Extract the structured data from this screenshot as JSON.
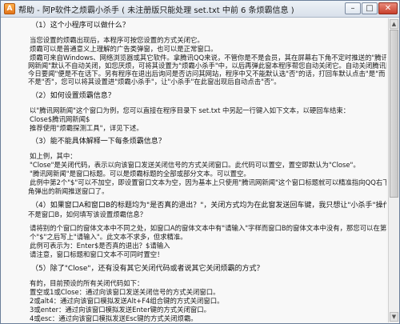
{
  "window": {
    "title": "帮助 - 阿P软件之烦霸小杀手 ( 未注册版只能处理 set.txt 中前 6 条烦霸信息 )",
    "app_icon": "A",
    "min_icon": "–",
    "max_icon": "□",
    "close_icon": "✕"
  },
  "scrollbar": {
    "up": "▲",
    "down": "▼"
  },
  "content": {
    "q1": "（1）这个小程序可以做什么？",
    "p1_l1": "当您设置的烦霸出现后，本程序可按您设置的方式关闭它。",
    "p1_l2": "烦霸可以是普通意义上理解的广告类弹窗，也可以是正常窗口。",
    "p1_l3": "烦霸可来自Windows、网络浏览器或其它软件。拿腾讯QQ来说，不管你是不是会员，其在屏幕右下角不定时推送的\"腾讯",
    "p1_l4": "网新闻\"默认不自动关闭，如您厌烦，可将其设置为\"烦霸小杀手\"中，以后再弹此窗本程序帮您自动关闭它。自动关闭腾讯网的\"",
    "p1_l5": "今日要闻\"便是不在话下。另有程序在退出后询问是否访问其网站，程序中又不能默认选\"否\"的话，打回车默认点击\"是\"而",
    "p1_l6": "不是\"否\"，您可以将其设置进\"烦霸小杀手\"，让\"小杀手\"在此窗出现后自动点击\"否\"。",
    "q2": "（2）如何设置烦霸信息？",
    "p2_l1": "以\"腾讯网新闻\"这个窗口为例，您可以直接在程序目录下 set.txt 中另起一行键入如下文本，以硬回车结束：",
    "p2_l2": "Close$腾讯网新闻$",
    "p2_l3": "推荐使用\"烦霸探测工具\"，详见下述。",
    "q3": "（3）能不能具体解释一下每条烦霸信息？",
    "p3_l1": "如上例，其中：",
    "p3_l2": "\"Close\"是关闭代码，表示以向该窗口发送关闭信号的方式关闭窗口。此代码可以置空，置空即默认为\"Close\"。",
    "p3_l3": "\"腾讯网新闻\"是窗口标题。可以是烦霸标题的全部或部分文本。可以置空。",
    "p3_l4": "此例中第2个\"$\"可以不加空，即设置窗口文本为空，因为基本上只使用\"腾讯网新闻\"这个窗口标题就可以精准指向QQ右下",
    "p3_l5": "角弹出的新闻推送窗口了。",
    "q4": "（4）如果窗口A和窗口B的标题均为\"是否真的退出？\"，关闭方式均为在此窗发送回车键，我只想让\"小杀手\"操作窗口A而",
    "q4b": "不是窗口B，如何填写该设置烦霸信息？",
    "p4_l1": "请将别的个窗口的窗体文本中不同之处，如窗口A的窗体文本中有\"请输入\"字样而窗口B的窗体文本中没有，那您可以在第2",
    "p4_l2": "个\"$\"之后写上\"请输入\"。此文本不求多，但求精准。",
    "p4_l3": "此例可表示为：Enter$是否真的退出？$请输入",
    "p4_l4": "请注意，窗口标题和窗口文本不可同时置空！",
    "q5": "（5）除了\"Close\"，还有没有其它关闭代码或者说其它关闭烦霸的方式？",
    "p5_l1": "有的，目前预设的所有关闭代码如下：",
    "p5_l2": "置空或1或Close：通过向该窗口发送关闭信号的方式关闭窗口。",
    "p5_l3": "2或alt4：通过向该窗口模拟发送Alt+F4组合键的方式关闭窗口。",
    "p5_l4": "3或enter：通过向该窗口模拟发送Enter键的方式关闭窗口。",
    "p5_l5": "4或esc：通过向该窗口模拟发送Esc键的方式关闭烦霸。"
  }
}
